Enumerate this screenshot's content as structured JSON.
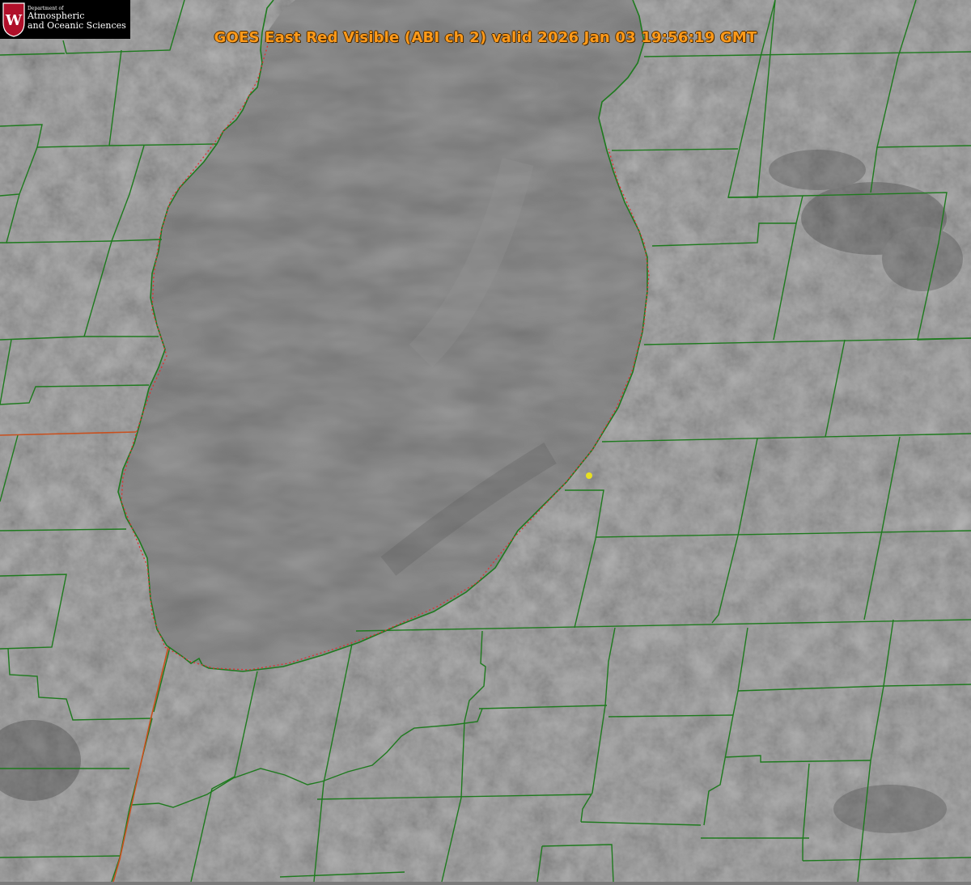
{
  "title": "GOES East Red Visible (ABI ch 2) valid 2026 Jan 03 19:56:19 GMT",
  "logo": {
    "department": "Department of",
    "line1": "Atmospheric",
    "line2": "and Oceanic Sciences",
    "crest_letter": "W"
  },
  "colors": {
    "county_border": "#1e7a1e",
    "state_border": "#c8501e",
    "shoreline_dots": "#e03030",
    "marker": "#e8e020",
    "title_text": "#ff9a1a"
  },
  "imagery": {
    "sensor": "GOES East",
    "band": "Red Visible (ABI ch 2)",
    "valid_time": "2026 Jan 03 19:56:19 GMT"
  }
}
